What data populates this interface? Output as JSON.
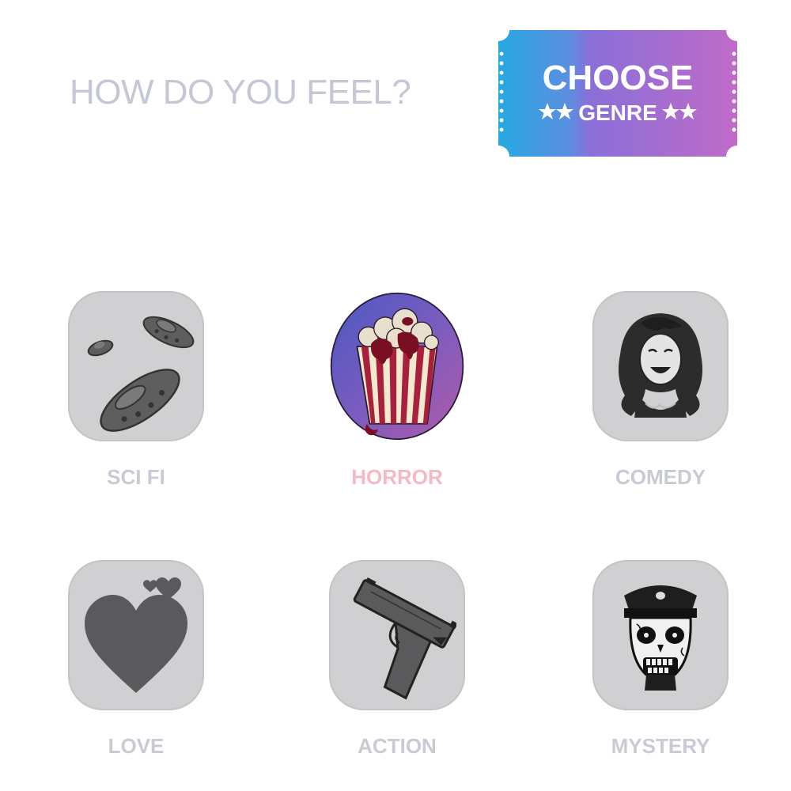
{
  "header": {
    "question": "HOW DO YOU FEEL?"
  },
  "ticket": {
    "line1": "CHOOSE",
    "line2": "GENRE",
    "gradient_start": "#2aa6e0",
    "gradient_end": "#b464c6"
  },
  "genres": [
    {
      "label": "SCI FI",
      "icon": "ufo-icon",
      "selected": false
    },
    {
      "label": "HORROR",
      "icon": "bloody-popcorn-icon",
      "selected": true
    },
    {
      "label": "COMEDY",
      "icon": "laughing-woman-icon",
      "selected": false
    },
    {
      "label": "LOVE",
      "icon": "heart-icon",
      "selected": false
    },
    {
      "label": "ACTION",
      "icon": "pistol-icon",
      "selected": false
    },
    {
      "label": "MYSTERY",
      "icon": "skull-officer-icon",
      "selected": false
    }
  ],
  "colors": {
    "label_default": "#c8cad4",
    "label_selected": "#f7b8c6",
    "tile_background": "#d0d0d2",
    "icon_dark": "#5a5a5c"
  }
}
